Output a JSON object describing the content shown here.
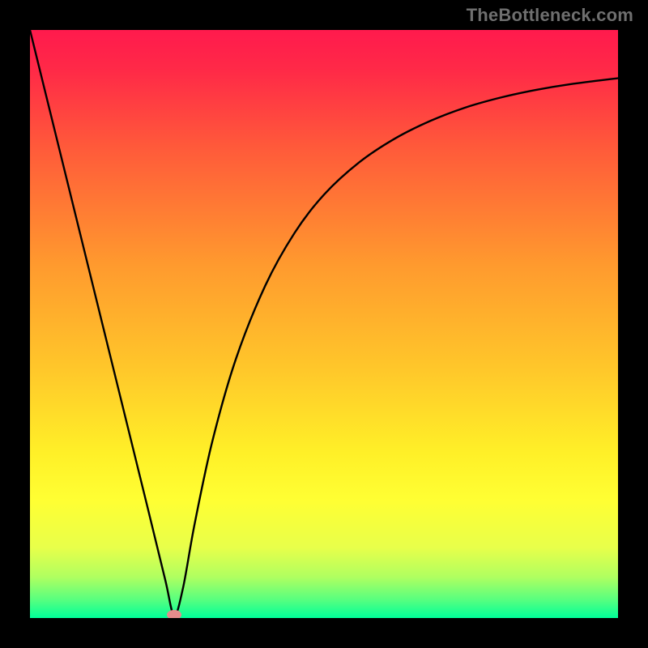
{
  "watermark": "TheBottleneck.com",
  "chart_data": {
    "type": "line",
    "title": "",
    "xlabel": "",
    "ylabel": "",
    "xlim_fraction": [
      0,
      1
    ],
    "ylim_fraction": [
      0,
      1
    ],
    "description": "Single black V-shaped bottleneck curve over a vertical red→yellow→green gradient. Left branch is nearly straight from top-left down to the minimum; right branch rises with decreasing slope toward upper right. A small pink oval marker sits at the curve minimum near the bottom.",
    "background_gradient_stops": [
      {
        "offset": 0.0,
        "color": "#ff1a4d"
      },
      {
        "offset": 0.07,
        "color": "#ff2a47"
      },
      {
        "offset": 0.2,
        "color": "#ff5a3a"
      },
      {
        "offset": 0.4,
        "color": "#ff9a2e"
      },
      {
        "offset": 0.58,
        "color": "#ffc82a"
      },
      {
        "offset": 0.72,
        "color": "#fff028"
      },
      {
        "offset": 0.8,
        "color": "#ffff33"
      },
      {
        "offset": 0.88,
        "color": "#e8ff4a"
      },
      {
        "offset": 0.93,
        "color": "#b0ff60"
      },
      {
        "offset": 0.97,
        "color": "#55ff80"
      },
      {
        "offset": 1.0,
        "color": "#00ff99"
      }
    ],
    "series": [
      {
        "name": "bottleneck-curve",
        "color": "#000000",
        "x": [
          0.0,
          0.05,
          0.1,
          0.15,
          0.2,
          0.23,
          0.245,
          0.26,
          0.28,
          0.31,
          0.35,
          0.4,
          0.45,
          0.5,
          0.56,
          0.62,
          0.68,
          0.74,
          0.8,
          0.86,
          0.92,
          1.0
        ],
        "y": [
          1.0,
          0.797,
          0.594,
          0.391,
          0.188,
          0.065,
          0.005,
          0.05,
          0.16,
          0.3,
          0.44,
          0.565,
          0.655,
          0.72,
          0.775,
          0.815,
          0.845,
          0.868,
          0.885,
          0.898,
          0.908,
          0.918
        ]
      }
    ],
    "marker": {
      "x_fraction": 0.245,
      "y_fraction": 0.005,
      "color": "#e58c8c"
    }
  }
}
